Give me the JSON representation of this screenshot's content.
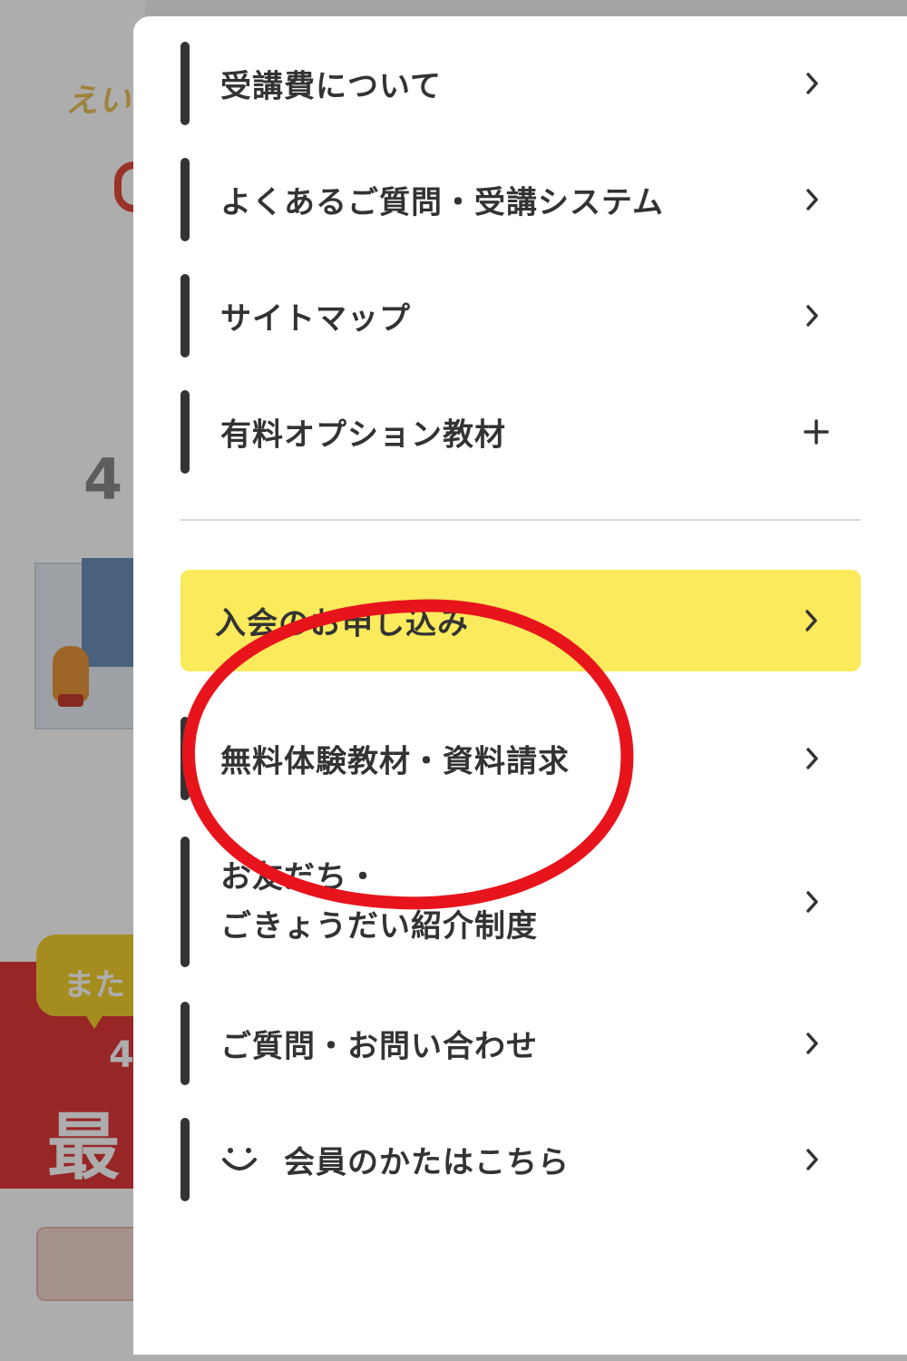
{
  "background_page": {
    "logo_text": "えい",
    "big_number": "4",
    "speech_text": "また",
    "red_block_number": "4",
    "red_block_big_text": "最"
  },
  "menu": {
    "items": [
      {
        "label": "受講費について",
        "action_icon": "chevron-right-icon"
      },
      {
        "label": "よくあるご質問・受講システム",
        "action_icon": "chevron-right-icon"
      },
      {
        "label": "サイトマップ",
        "action_icon": "chevron-right-icon"
      },
      {
        "label": "有料オプション教材",
        "action_icon": "plus-icon"
      }
    ],
    "join": {
      "label": "入会のお申し込み",
      "color": "#faea5c",
      "action_icon": "chevron-right-icon"
    },
    "sub_items": [
      {
        "label": "無料体験教材・資料請求",
        "action_icon": "chevron-right-icon"
      },
      {
        "label_line1": "お友だち・",
        "label_line2": "ごきょうだい紹介制度",
        "action_icon": "chevron-right-icon"
      },
      {
        "label": "ご質問・お問い合わせ",
        "action_icon": "chevron-right-icon"
      },
      {
        "label": "会員のかたはこちら",
        "leading_icon": "smile-icon",
        "action_icon": "chevron-right-icon"
      }
    ]
  },
  "annotation": {
    "shape": "ellipse",
    "color": "#e8141c",
    "target": "無料体験教材・資料請求"
  }
}
